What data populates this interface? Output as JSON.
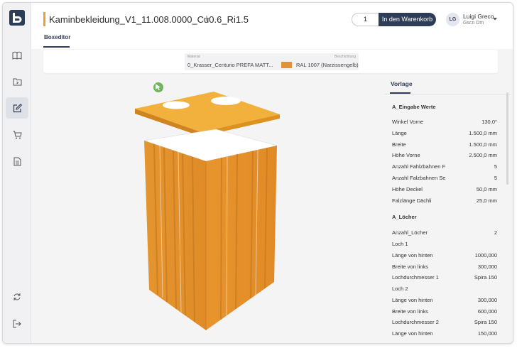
{
  "header": {
    "title": "Kaminbekleidung_V1_11.008.0000_Cu0.6_Ri1.5",
    "add_tab": "+",
    "quantity": "1",
    "add_to_cart": "In den Warenkorb",
    "user": {
      "initials": "LG",
      "name": "Luigi Greco",
      "org": "Gscn Dm"
    },
    "tab": "Boxeditor"
  },
  "material": {
    "label": "Material",
    "value": "0_Krasser_Centurio PREFA MATT...",
    "desc_label": "Beschichtung",
    "desc_value": "RAL 1007 (Narzissengelb)",
    "swatch_color": "#e09236"
  },
  "panel": {
    "tab": "Vorlage",
    "section1": "A_Eingabe Werte",
    "eingabe": [
      {
        "key": "Winkel Vorne",
        "val": "130,0°"
      },
      {
        "key": "Länge",
        "val": "1.500,0 mm"
      },
      {
        "key": "Breite",
        "val": "1.500,0 mm"
      },
      {
        "key": "Höhe Vorne",
        "val": "2.500,0 mm"
      },
      {
        "key": "Anzahl Fahlzbahnen F",
        "val": "5"
      },
      {
        "key": "Anzahl Falzbahnen Se",
        "val": "5"
      },
      {
        "key": "Höhe Deckel",
        "val": "50,0 mm"
      },
      {
        "key": "Falzlänge Dächli",
        "val": "25,0 mm"
      }
    ],
    "section2": "A_Löcher",
    "loecher": [
      {
        "key": "Anzahl_Löcher",
        "val": "2"
      },
      {
        "key": "Loch 1",
        "val": ""
      },
      {
        "key": "Länge von hinten",
        "val": "1000,000"
      },
      {
        "key": "Breite von links",
        "val": "300,000"
      },
      {
        "key": "Lochdurchmesser 1",
        "val": "Spira 150"
      },
      {
        "key": "Loch 2",
        "val": ""
      },
      {
        "key": "Länge von hinten",
        "val": "300,000"
      },
      {
        "key": "Breite von links",
        "val": "600,000"
      },
      {
        "key": "Lochdurchmesser 2",
        "val": "Spira 150"
      },
      {
        "key": "Länge von hinten",
        "val": "150,000"
      }
    ]
  },
  "sidebar": {
    "icons": [
      "book-icon",
      "folder-icon",
      "edit-icon",
      "cart-icon",
      "document-icon",
      "sync-icon",
      "logout-icon"
    ]
  },
  "colors": {
    "accent": "#2e3d57",
    "orange": "#e8a030",
    "box": "#e09236"
  }
}
